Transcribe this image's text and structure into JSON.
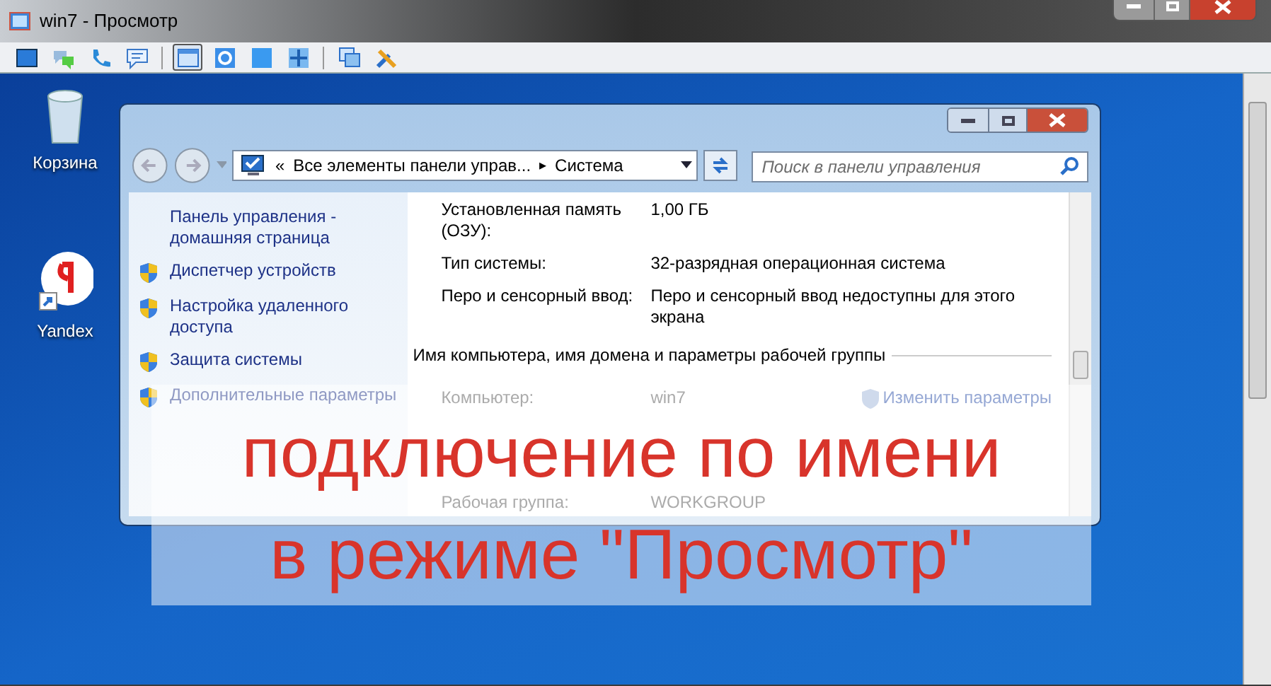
{
  "window": {
    "title": "win7 - Просмотр"
  },
  "toolbar": [
    {
      "kind": "screen",
      "selected": false
    },
    {
      "kind": "chat",
      "selected": false
    },
    {
      "kind": "phone",
      "selected": false
    },
    {
      "kind": "message",
      "selected": false
    },
    {
      "kind": "window",
      "selected": true
    },
    {
      "kind": "fit",
      "selected": false
    },
    {
      "kind": "full",
      "selected": false
    },
    {
      "kind": "stretch",
      "selected": false
    },
    {
      "kind": "monitors",
      "selected": false
    },
    {
      "kind": "tools",
      "selected": false
    }
  ],
  "desktop_icons": [
    {
      "kind": "recycle",
      "label": "Корзина"
    },
    {
      "kind": "yandex",
      "label": "Yandex"
    }
  ],
  "explorer": {
    "address": {
      "prefix": "«",
      "path": "Все элементы панели управ...",
      "separator": "▸",
      "current": "Система"
    },
    "search": {
      "placeholder": "Поиск в панели управления"
    },
    "sidebar": [
      {
        "label": "Панель управления - домашняя страница",
        "shield": false
      },
      {
        "label": "Диспетчер устройств",
        "shield": true
      },
      {
        "label": "Настройка удаленного доступа",
        "shield": true
      },
      {
        "label": "Защита системы",
        "shield": true
      },
      {
        "label": "Дополнительные параметры",
        "shield": true
      }
    ],
    "properties": [
      {
        "name": "Установленная память (ОЗУ):",
        "value": "1,00 ГБ"
      },
      {
        "name": "Тип системы:",
        "value": "32-разрядная операционная система"
      },
      {
        "name": "Перо и сенсорный ввод:",
        "value": "Перо и сенсорный ввод недоступны для этого экрана"
      }
    ],
    "section_title": "Имя компьютера, имя домена и параметры рабочей группы",
    "computer": [
      {
        "name": "Компьютер:",
        "value": "win7"
      },
      {
        "name": "Рабочая группа:",
        "value": "WORKGROUP"
      }
    ],
    "change_link": "Изменить параметры"
  },
  "caption": [
    "подключение по имени",
    "в режиме \"Просмотр\""
  ]
}
